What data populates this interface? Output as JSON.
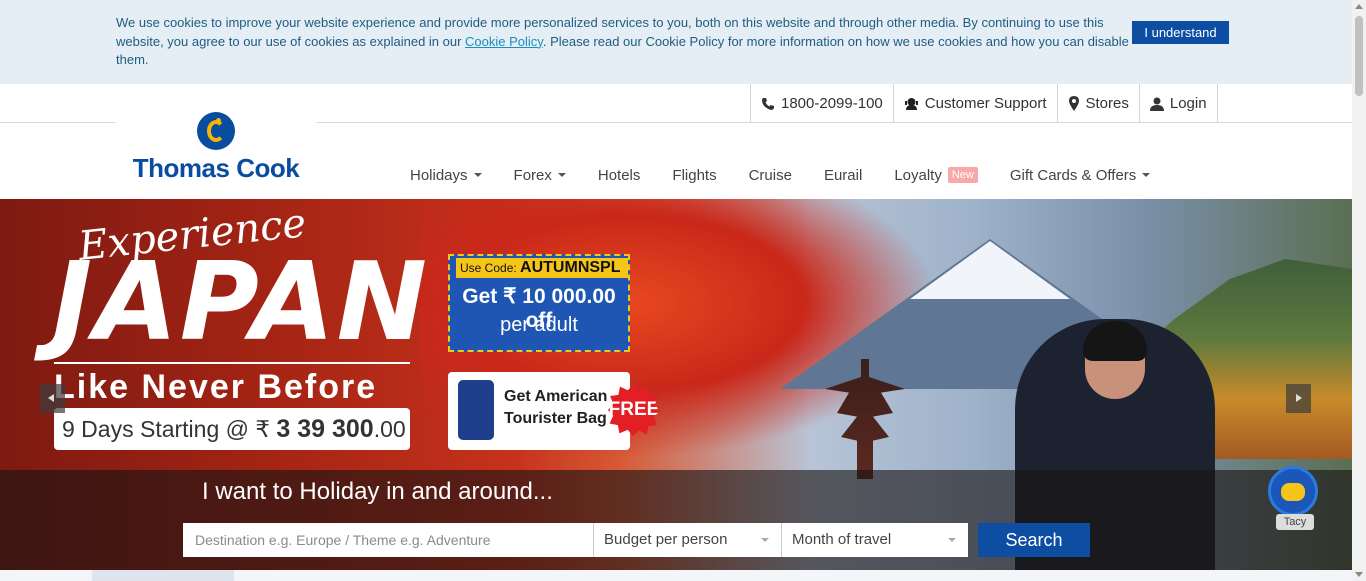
{
  "cookie": {
    "text_before": "We use cookies to improve your website experience and provide more personalized services to you, both on this website and through other media. By continuing to use this website, you agree to our use of cookies as explained in our ",
    "link": "Cookie Policy",
    "text_after": ". Please read our Cookie Policy for more information on how we use cookies and how you can disable them.",
    "button": "I understand"
  },
  "topbar": {
    "phone": "1800-2099-100",
    "support": "Customer Support",
    "stores": "Stores",
    "login": "Login"
  },
  "brand": {
    "name": "Thomas Cook",
    "color": "#0a4da0",
    "accent": "#f7b500"
  },
  "nav": {
    "items": [
      {
        "label": "Holidays",
        "dropdown": true
      },
      {
        "label": "Forex",
        "dropdown": true
      },
      {
        "label": "Hotels"
      },
      {
        "label": "Flights"
      },
      {
        "label": "Cruise"
      },
      {
        "label": "Eurail"
      },
      {
        "label": "Loyalty",
        "badge": "New"
      },
      {
        "label": "Gift Cards & Offers",
        "dropdown": true
      }
    ]
  },
  "hero": {
    "script": "Experience",
    "title": "JAPAN",
    "subtitle": "Like Never Before",
    "days_prefix": "9 Days Starting @ ₹ ",
    "price_main": "3 39 300",
    "price_decimal": ".00",
    "promo_label": "Use Code:",
    "promo_code": "AUTUMNSPL",
    "promo_off": "Get ₹ 10 000.00 off",
    "promo_unit": "per adult",
    "bag_line1": "Get American",
    "bag_line2": "Tourister Bag",
    "free": "FREE"
  },
  "search": {
    "heading": "I want to Holiday in and around...",
    "destination_placeholder": "Destination e.g. Europe / Theme e.g. Adventure",
    "budget": "Budget per person",
    "month": "Month of travel",
    "button": "Search"
  },
  "chatbot": {
    "label": "Tacy"
  }
}
